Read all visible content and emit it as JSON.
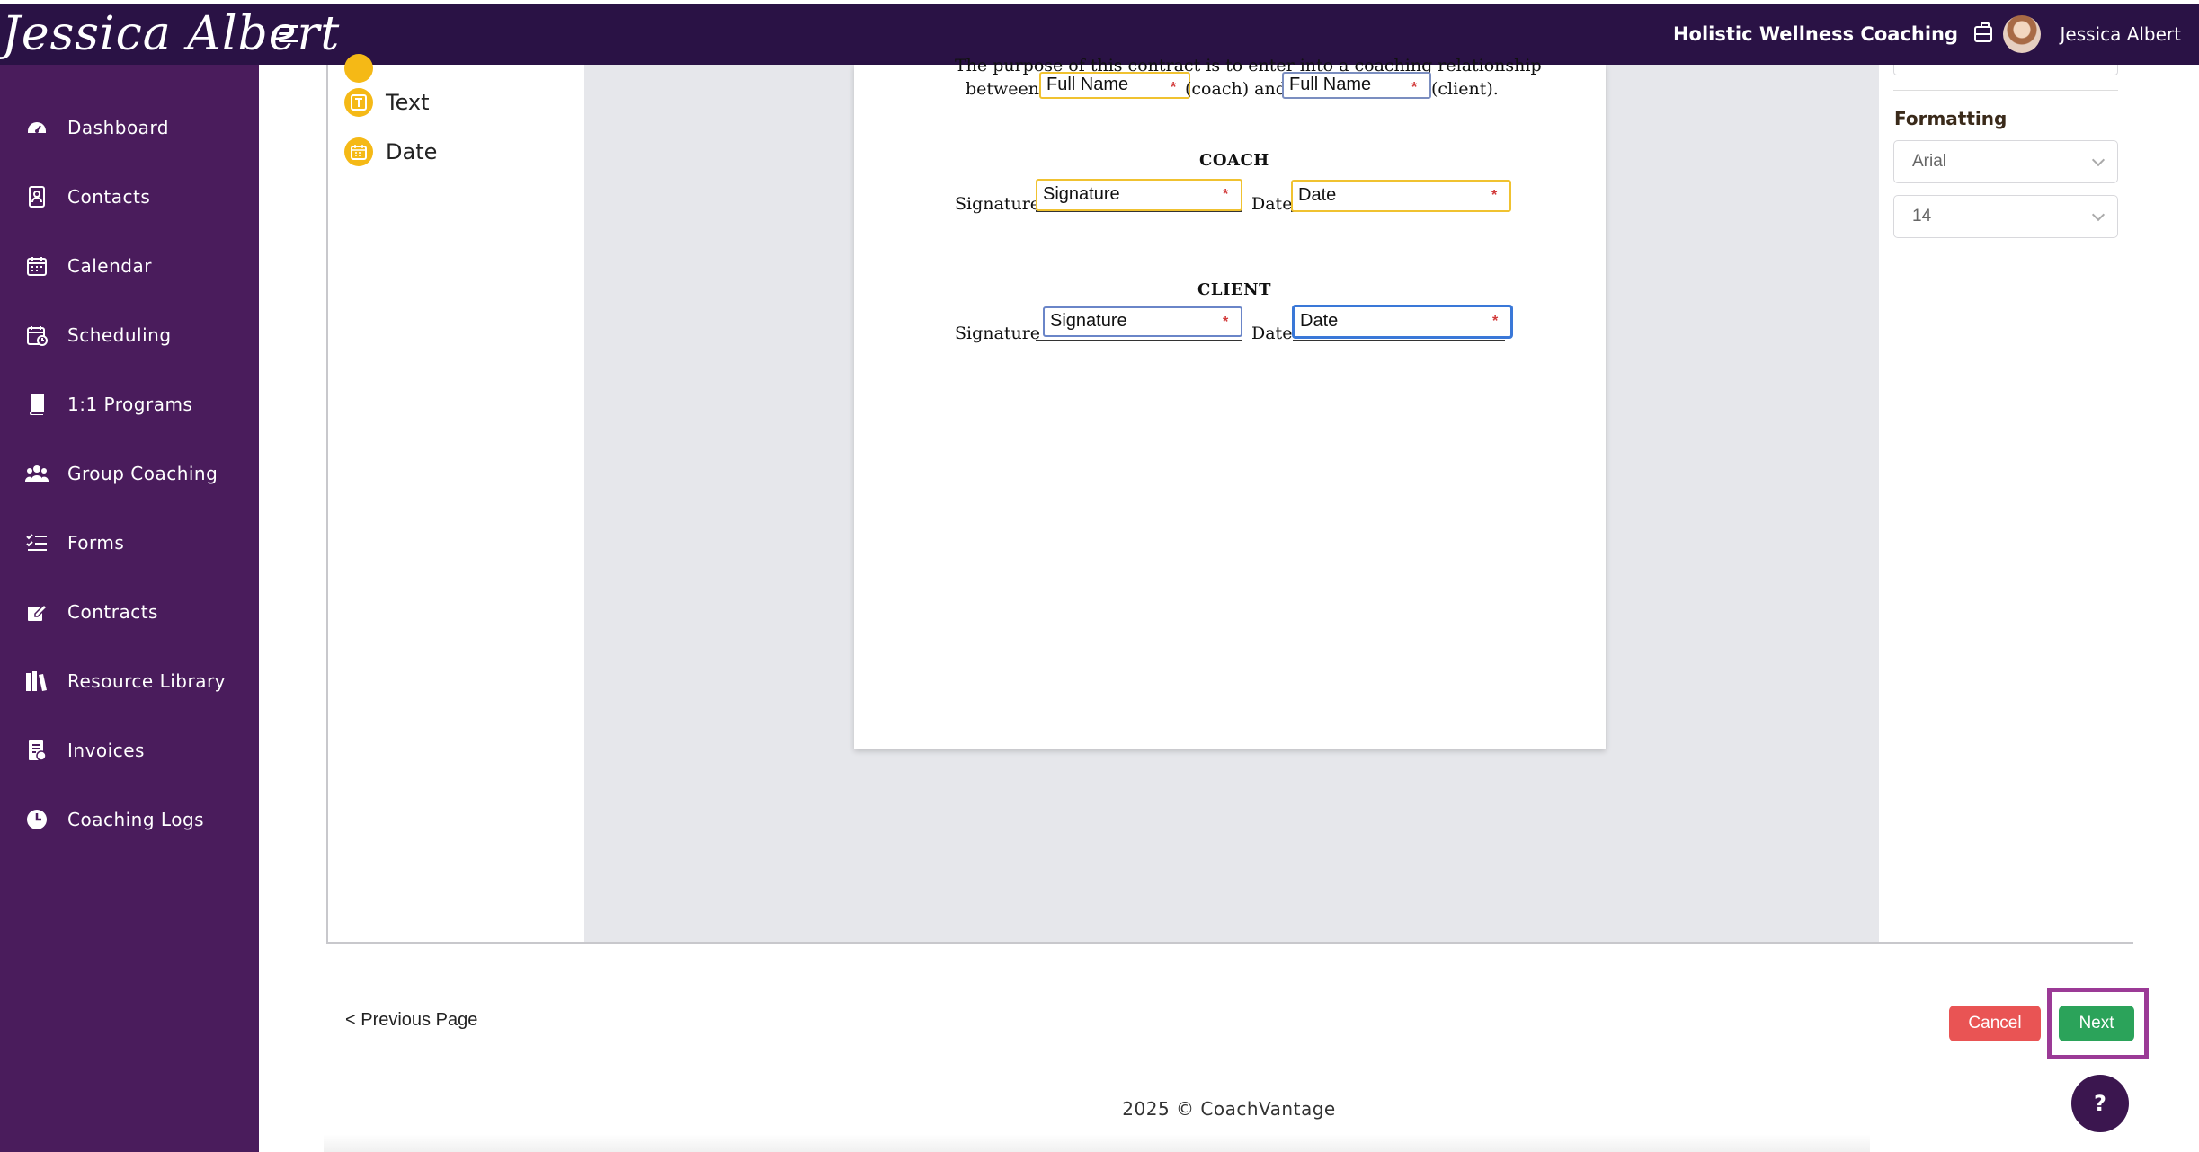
{
  "header": {
    "logo_text": "Jessica Albert",
    "business_name": "Holistic Wellness Coaching",
    "user_name": "Jessica Albert"
  },
  "sidebar": {
    "items": [
      {
        "label": "Dashboard",
        "icon": "dashboard-icon"
      },
      {
        "label": "Contacts",
        "icon": "contacts-icon"
      },
      {
        "label": "Calendar",
        "icon": "calendar-icon"
      },
      {
        "label": "Scheduling",
        "icon": "scheduling-icon"
      },
      {
        "label": "1:1 Programs",
        "icon": "book-icon"
      },
      {
        "label": "Group Coaching",
        "icon": "group-icon"
      },
      {
        "label": "Forms",
        "icon": "forms-icon"
      },
      {
        "label": "Contracts",
        "icon": "contract-icon"
      },
      {
        "label": "Resource Library",
        "icon": "library-icon"
      },
      {
        "label": "Invoices",
        "icon": "invoice-icon"
      },
      {
        "label": "Coaching Logs",
        "icon": "clock-icon"
      }
    ]
  },
  "field_types": [
    {
      "label": "Text",
      "icon": "text-field-icon"
    },
    {
      "label": "Date",
      "icon": "date-field-icon"
    }
  ],
  "document": {
    "intro_line1": "The purpose of this contract is to enter into a coaching relationship",
    "intro_between": "between",
    "intro_coach": "(coach) and",
    "intro_client": "(client).",
    "coach_heading": "COACH",
    "client_heading": "CLIENT",
    "signature_label": "Signature",
    "date_label": "Date",
    "fields": {
      "coach_full_name": "Full Name",
      "client_full_name": "Full Name",
      "coach_signature": "Signature",
      "coach_date": "Date",
      "client_signature": "Signature",
      "client_date": "Date"
    }
  },
  "right_panel": {
    "formatting_title": "Formatting",
    "font_family": "Arial",
    "font_size": "14"
  },
  "footer": {
    "previous_page": "< Previous Page",
    "cancel": "Cancel",
    "next": "Next",
    "copyright": "2025 © CoachVantage",
    "help": "?"
  },
  "colors": {
    "topbar": "#2a1245",
    "sidebar": "#4a1c5c",
    "field_icon": "#f5b916",
    "cancel": "#e95454",
    "next": "#2ba35a",
    "highlight": "#9b3a96"
  }
}
